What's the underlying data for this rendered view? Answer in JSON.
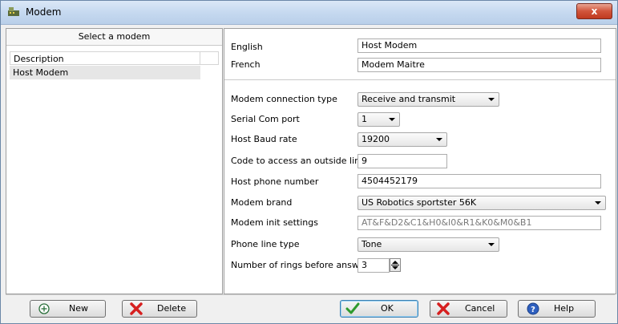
{
  "window": {
    "title": "Modem",
    "close_label": "x"
  },
  "left": {
    "panel_title": "Select a modem",
    "column_header": "Description",
    "rows": [
      "Host Modem"
    ]
  },
  "right": {
    "english_label": "English",
    "english_value": "Host Modem",
    "french_label": "French",
    "french_value": "Modem Maitre",
    "conn_type_label": "Modem connection type",
    "conn_type_value": "Receive and transmit",
    "com_port_label": "Serial Com port",
    "com_port_value": "1",
    "baud_label": "Host Baud rate",
    "baud_value": "19200",
    "outside_line_label": "Code to access an outside line",
    "outside_line_value": "9",
    "phone_label": "Host phone number",
    "phone_value": "4504452179",
    "brand_label": "Modem brand",
    "brand_value": "US Robotics sportster 56K",
    "init_label": "Modem init settings",
    "init_value": "AT&F&D2&C1&H0&I0&R1&K0&M0&B1",
    "line_type_label": "Phone line type",
    "line_type_value": "Tone",
    "rings_label": "Number of rings before answer",
    "rings_value": "3"
  },
  "buttons": {
    "new": "New",
    "delete": "Delete",
    "ok": "OK",
    "cancel": "Cancel",
    "help": "Help"
  },
  "colors": {
    "accent": "#3c7fb1",
    "delete_red": "#d61f1f",
    "ok_green": "#2e9a2e"
  }
}
